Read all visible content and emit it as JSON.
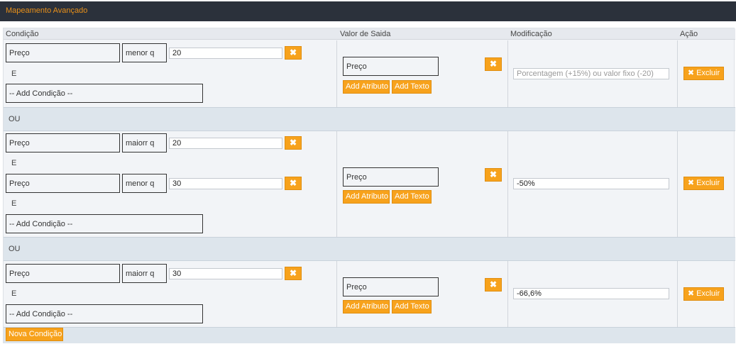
{
  "window": {
    "title": "Mapeamento Avançado"
  },
  "table": {
    "headers": {
      "condition": "Condição",
      "output": "Valor de Saida",
      "modification": "Modificação",
      "action": "Ação"
    },
    "or_label": "OU",
    "and_label": "E",
    "add_condition_label": "-- Add Condição --",
    "add_attribute_label": "Add Atributo",
    "add_text_label": "Add Texto",
    "delete_label": "Excluir",
    "remove_icon": "close-icon",
    "modification_placeholder": "Porcentagem (+15%) ou valor fixo (-20)",
    "rules": [
      {
        "conditions": [
          {
            "field": "Preço",
            "operator": "menor q",
            "value": "20"
          }
        ],
        "output": "Preço",
        "modification": ""
      },
      {
        "conditions": [
          {
            "field": "Preço",
            "operator": "maiorr q",
            "value": "20"
          },
          {
            "field": "Preço",
            "operator": "menor q",
            "value": "30"
          }
        ],
        "output": "Preço",
        "modification": "-50%"
      },
      {
        "conditions": [
          {
            "field": "Preço",
            "operator": "maiorr q",
            "value": "30"
          }
        ],
        "output": "Preço",
        "modification": "-66,6%"
      }
    ]
  },
  "footer": {
    "new_condition_label": "Nova Condição"
  },
  "colors": {
    "accent": "#f7a21c",
    "titlebar": "#2b313b",
    "title_text": "#e8901a"
  }
}
